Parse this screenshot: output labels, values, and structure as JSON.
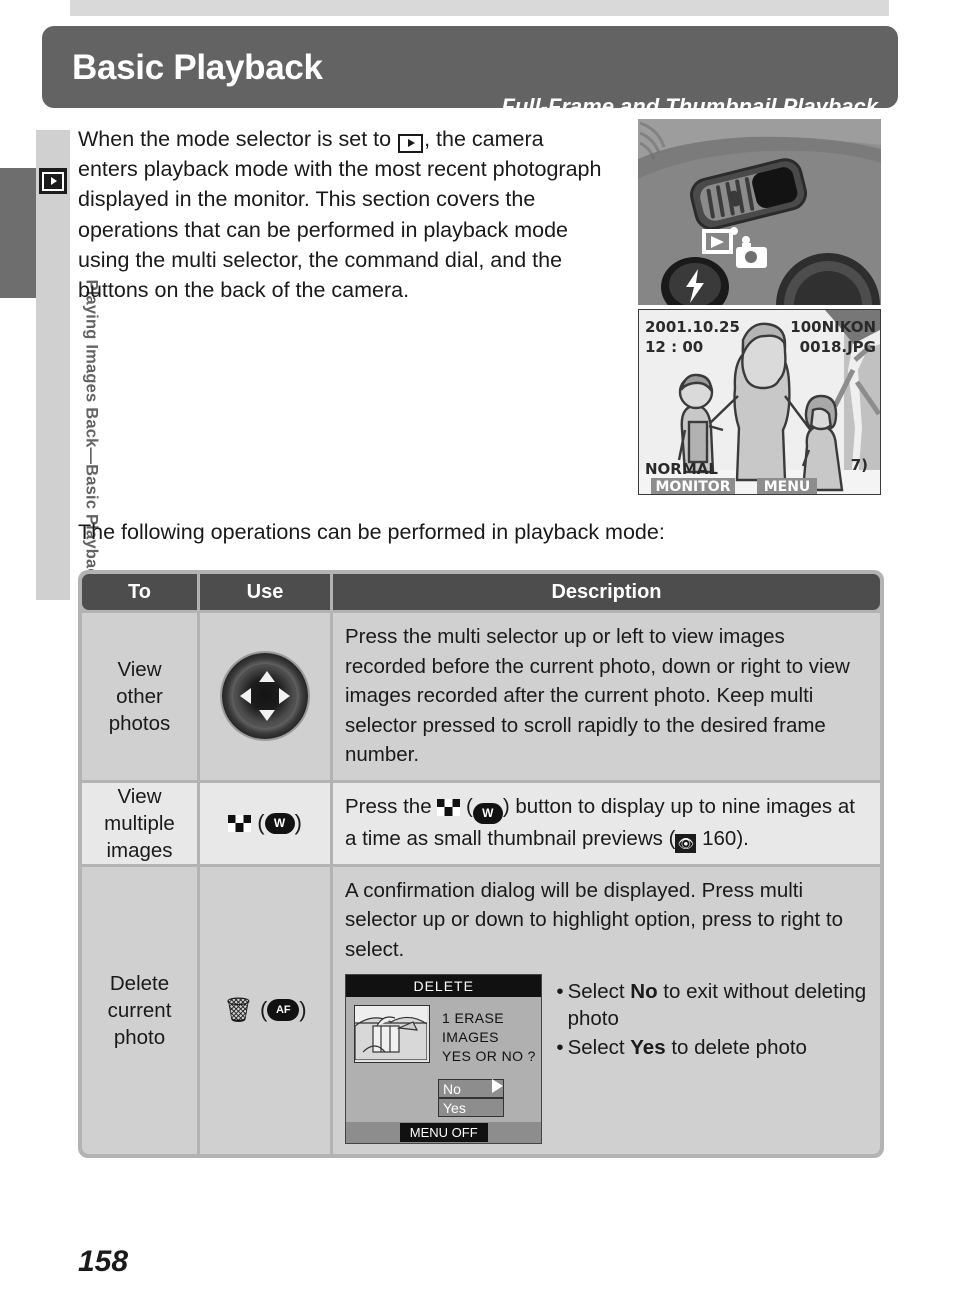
{
  "page": {
    "number": "158",
    "side_tab_label": "Playing Images Back—Basic Playback",
    "side_tab_icon": "playback-icon"
  },
  "header": {
    "title": "Basic Playback",
    "subtitle": "Full-Frame and Thumbnail Playback"
  },
  "intro": {
    "part1": "When the mode selector is set to ",
    "icon": "playback-mode-icon",
    "part2": ", the camera enters playback mode with the most recent photograph displayed in the monitor.  This section covers the operations that can be performed in playback mode using the multi selector, the command dial, and the buttons on the back of the camera."
  },
  "lead_in": "The following operations can be performed in playback mode:",
  "figures": {
    "mode_dial": {
      "name": "camera-mode-selector-photo",
      "playback_mark": "playback-icon",
      "camera_mark": "camera-icon",
      "flash_button": "flash-icon"
    },
    "monitor": {
      "name": "camera-monitor-photo",
      "date": "2001.10.25",
      "time": "12 : 00",
      "folder": "100NIKON",
      "filename": "0018.JPG",
      "quality": "NORMAL",
      "button_left": "MONITOR",
      "button_right": "MENU",
      "frame_counter": "7)"
    }
  },
  "table": {
    "headers": [
      "To",
      "Use",
      "Description"
    ],
    "rows": [
      {
        "to": "View\nother\nphotos",
        "use_icon": "multi-selector-icon",
        "description": "Press the multi selector up or left to view images recorded before the current photo, down or right to view images recorded after the current photo.  Keep multi selector pressed to scroll rapidly to the desired frame number."
      },
      {
        "to": "View\nmultiple\nimages",
        "use_icon": "thumbnail-button-icon",
        "use_button_label": "W",
        "desc_pre": "Press the ",
        "desc_mid": " button to display up to nine images at a time as small thumbnail previews (",
        "desc_ref_page": "160",
        "desc_post": ")."
      },
      {
        "to": "Delete\ncurrent\nphoto",
        "use_icon": "trash-button-icon",
        "use_button_label": "AF",
        "description": "A confirmation dialog will be displayed.  Press multi selector up or down to highlight option, press to right to select.",
        "dialog": {
          "title": "DELETE",
          "message_line1": "1 ERASE  IMAGES",
          "message_line2": "YES OR NO  ?",
          "option_no": "No",
          "option_yes": "Yes",
          "footer": "MENU OFF",
          "thumbnail": "photo-thumbnail"
        },
        "bullets": [
          {
            "dot": "•",
            "pre": "Select ",
            "bold": "No",
            "post": " to exit without deleting photo"
          },
          {
            "dot": "•",
            "pre": "Select ",
            "bold": "Yes",
            "post": " to delete photo"
          }
        ]
      }
    ]
  }
}
